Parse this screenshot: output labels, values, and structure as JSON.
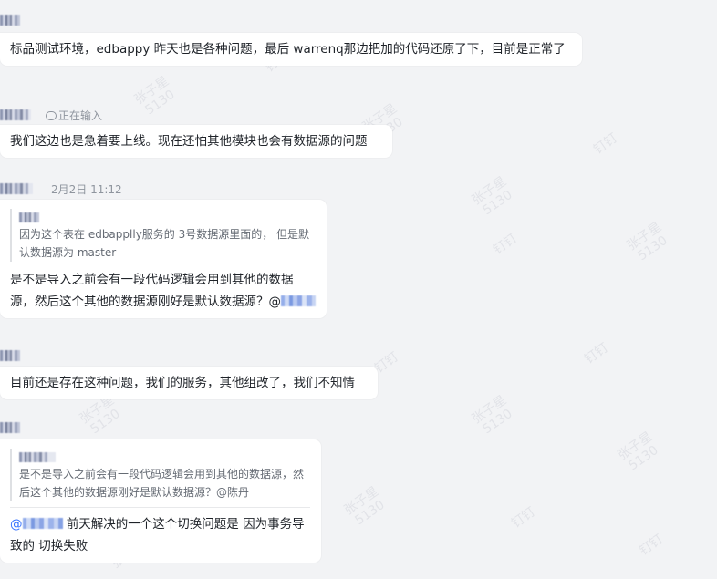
{
  "messages": [
    {
      "text": "标品测试环境，edbappy 昨天也是各种问题，最后 warrenq那边把加的代码还原了下，目前是正常了"
    },
    {
      "status": "正在输入",
      "text": "我们这边也是急着要上线。现在还怕其他模块也会有数据源的问题"
    },
    {
      "timestamp": "2月2日 11:12",
      "quote": "因为这个表在  edbapplly服务的 3号数据源里面的，  但是默认数据源为 master",
      "text": "是不是导入之前会有一段代码逻辑会用到其他的数据源，然后这个其他的数据源刚好是默认数据源？@"
    },
    {
      "text": "目前还是存在这种问题，我们的服务，其他组改了，我们不知情"
    },
    {
      "quote": "是不是导入之前会有一段代码逻辑会用到其他的数据源，然后这个其他的数据源刚好是默认数据源？@陈丹",
      "text_prefix": "@",
      "text": " 前天解决的一个这个切换问题是 因为事务导致的 切换失败"
    }
  ],
  "watermark": {
    "lines": [
      "张子星",
      "5130",
      "钉钉"
    ]
  }
}
